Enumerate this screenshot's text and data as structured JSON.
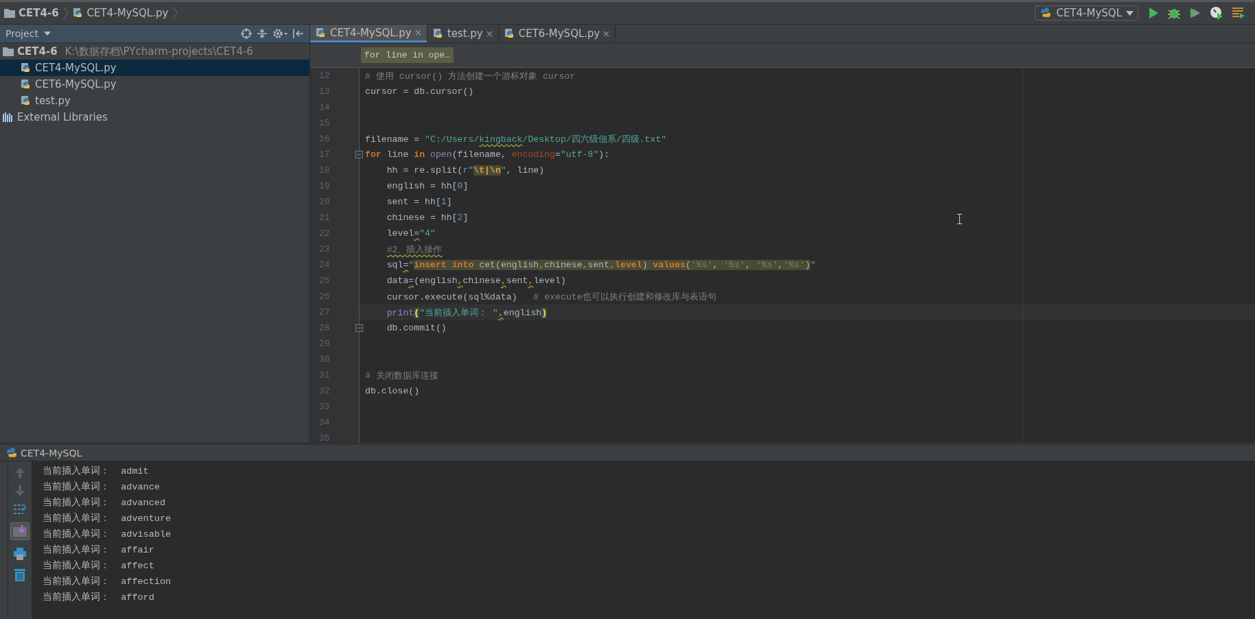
{
  "navbar": {
    "crumbs": [
      {
        "label": "CET4-6",
        "kind": "folder"
      },
      {
        "label": "CET4-MySQL.py",
        "kind": "file"
      }
    ],
    "run_config": "CET4-MySQL"
  },
  "project": {
    "title": "Project",
    "tree": [
      {
        "label": "CET4-6",
        "path": "K:\\数据存档\\PYcharm-projects\\CET4-6",
        "kind": "folder",
        "selected": false,
        "children": [
          {
            "label": "CET4-MySQL.py",
            "kind": "python",
            "selected": true
          },
          {
            "label": "CET6-MySQL.py",
            "kind": "python",
            "selected": false
          },
          {
            "label": "test.py",
            "kind": "python",
            "selected": false
          }
        ]
      },
      {
        "label": "External Libraries",
        "kind": "library",
        "selected": false
      }
    ]
  },
  "tabs": [
    {
      "label": "CET4-MySQL.py",
      "selected": true
    },
    {
      "label": "test.py",
      "selected": false
    },
    {
      "label": "CET6-MySQL.py",
      "selected": false
    }
  ],
  "breadcrumb_hint": "for line in ope…",
  "code": [
    {
      "number": "12",
      "current": false,
      "fold": false,
      "tokens": [
        {
          "text": "# 使用 cursor() 方法创建一个游标对象 cursor",
          "kind": "comment"
        }
      ]
    },
    {
      "number": "13",
      "current": false,
      "fold": false,
      "tokens": [
        {
          "text": "cursor = db.cursor()",
          "kind": "plain"
        }
      ]
    },
    {
      "number": "14",
      "current": false,
      "fold": false
    },
    {
      "number": "15",
      "current": false,
      "fold": false
    },
    {
      "number": "16",
      "current": false,
      "fold": false,
      "tokens": [
        {
          "text": "filename = ",
          "kind": "plain"
        },
        {
          "text": "\"C:/Users/",
          "kind": "string"
        },
        {
          "text": "kingback",
          "kind": "string",
          "underlined": true
        },
        {
          "text": "/Desktop/四六级佃系/四级.txt\"",
          "kind": "string"
        }
      ]
    },
    {
      "number": "17",
      "current": false,
      "fold": true,
      "tokens": [
        {
          "text": "for",
          "kind": "keyword"
        },
        {
          "text": " line ",
          "kind": "plain"
        },
        {
          "text": "in",
          "kind": "keyword"
        },
        {
          "text": " open",
          "kind": "builtin"
        },
        {
          "text": "(filename, ",
          "kind": "plain"
        },
        {
          "text": "encoding",
          "kind": "param"
        },
        {
          "text": "=",
          "kind": "plain"
        },
        {
          "text": "\"utf-8\"",
          "kind": "string"
        },
        {
          "text": "):",
          "kind": "plain"
        }
      ]
    },
    {
      "number": "18",
      "current": false,
      "fold": false,
      "tokens": [
        {
          "text": "    hh = re.split(",
          "kind": "plain"
        },
        {
          "text": "r\"",
          "kind": "string"
        },
        {
          "text": "\\t|\\n",
          "kind": "escape",
          "highlighted": true
        },
        {
          "text": "\"",
          "kind": "string"
        },
        {
          "text": ", line)",
          "kind": "plain"
        }
      ]
    },
    {
      "number": "19",
      "current": false,
      "fold": false,
      "tokens": [
        {
          "text": "    english = hh[",
          "kind": "plain"
        },
        {
          "text": "0",
          "kind": "number"
        },
        {
          "text": "]",
          "kind": "plain"
        }
      ]
    },
    {
      "number": "20",
      "current": false,
      "fold": false,
      "tokens": [
        {
          "text": "    sent = hh[",
          "kind": "plain"
        },
        {
          "text": "1",
          "kind": "number"
        },
        {
          "text": "]",
          "kind": "plain"
        }
      ]
    },
    {
      "number": "21",
      "current": false,
      "fold": false,
      "tokens": [
        {
          "text": "    chinese = hh[",
          "kind": "plain"
        },
        {
          "text": "2",
          "kind": "number"
        },
        {
          "text": "]",
          "kind": "plain"
        }
      ]
    },
    {
      "number": "22",
      "current": false,
      "fold": false,
      "tokens": [
        {
          "text": "    level",
          "kind": "plain"
        },
        {
          "text": "=",
          "kind": "plain",
          "underlined": true
        },
        {
          "text": "\"4\"",
          "kind": "string"
        }
      ]
    },
    {
      "number": "23",
      "current": false,
      "fold": false,
      "tokens": [
        {
          "text": "    #2、插入操作",
          "kind": "comment",
          "underlined": true
        }
      ]
    },
    {
      "number": "24",
      "current": false,
      "fold": false,
      "tokens": [
        {
          "text": "    sql",
          "kind": "plain"
        },
        {
          "text": "=",
          "kind": "plain",
          "underlined": true
        },
        {
          "text": "\"",
          "kind": "string"
        },
        {
          "text": "insert into",
          "kind": "keyword",
          "highlighted": true
        },
        {
          "text": " cet(english",
          "kind": "plain",
          "highlighted": true
        },
        {
          "text": ",",
          "kind": "keyword",
          "highlighted": true
        },
        {
          "text": "chinese",
          "kind": "plain",
          "highlighted": true
        },
        {
          "text": ",",
          "kind": "keyword",
          "highlighted": true
        },
        {
          "text": "sent",
          "kind": "plain",
          "highlighted": true
        },
        {
          "text": ",",
          "kind": "keyword",
          "highlighted": true
        },
        {
          "text": "level",
          "kind": "keyword",
          "highlighted": true
        },
        {
          "text": ") ",
          "kind": "plain",
          "highlighted": true
        },
        {
          "text": "values",
          "kind": "keyword",
          "highlighted": true
        },
        {
          "text": "(",
          "kind": "plain",
          "highlighted": true
        },
        {
          "text": "'%s'",
          "kind": "format",
          "highlighted": true
        },
        {
          "text": ", ",
          "kind": "plain",
          "highlighted": true
        },
        {
          "text": "'%s'",
          "kind": "format",
          "highlighted": true
        },
        {
          "text": ", ",
          "kind": "plain",
          "highlighted": true
        },
        {
          "text": "'%s'",
          "kind": "format",
          "highlighted": true
        },
        {
          "text": ",",
          "kind": "plain",
          "highlighted": true
        },
        {
          "text": "'%s'",
          "kind": "format",
          "highlighted": true
        },
        {
          "text": ")",
          "kind": "plain",
          "highlighted": true
        },
        {
          "text": "\"",
          "kind": "string"
        }
      ]
    },
    {
      "number": "25",
      "current": false,
      "fold": false,
      "tokens": [
        {
          "text": "    data",
          "kind": "plain"
        },
        {
          "text": "=",
          "kind": "plain",
          "underlined": true
        },
        {
          "text": "(english",
          "kind": "plain"
        },
        {
          "text": ",",
          "kind": "keyword",
          "underlined": true
        },
        {
          "text": "chinese",
          "kind": "plain"
        },
        {
          "text": ",",
          "kind": "keyword",
          "underlined": true
        },
        {
          "text": "sent",
          "kind": "plain"
        },
        {
          "text": ",",
          "kind": "keyword",
          "underlined": true
        },
        {
          "text": "level)",
          "kind": "plain"
        }
      ]
    },
    {
      "number": "26",
      "current": false,
      "fold": false,
      "tokens": [
        {
          "text": "    cursor.execute(sql%data)   ",
          "kind": "plain"
        },
        {
          "text": "# execute也可以执行创建和修改库与表语句",
          "kind": "comment"
        }
      ]
    },
    {
      "number": "27",
      "current": true,
      "fold": false,
      "tokens": [
        {
          "text": "    print",
          "kind": "builtin"
        },
        {
          "text": "(",
          "kind": "bracket",
          "highlighted": true
        },
        {
          "text": "\"当前插入单词： \"",
          "kind": "string"
        },
        {
          "text": ",",
          "kind": "keyword",
          "underlined": true
        },
        {
          "text": "english",
          "kind": "plain"
        },
        {
          "text": ")",
          "kind": "bracket",
          "highlighted": true
        }
      ]
    },
    {
      "number": "28",
      "current": false,
      "fold": true,
      "tokens": [
        {
          "text": "    db.commit()",
          "kind": "plain"
        }
      ]
    },
    {
      "number": "29",
      "current": false,
      "fold": false
    },
    {
      "number": "30",
      "current": false,
      "fold": false
    },
    {
      "number": "31",
      "current": false,
      "fold": false,
      "tokens": [
        {
          "text": "# 关闭数据库连接",
          "kind": "comment"
        }
      ]
    },
    {
      "number": "32",
      "current": false,
      "fold": false,
      "tokens": [
        {
          "text": "db.close()",
          "kind": "plain"
        }
      ]
    },
    {
      "number": "33",
      "current": false,
      "fold": false
    },
    {
      "number": "34",
      "current": false,
      "fold": false
    },
    {
      "number": "35",
      "current": false,
      "fold": false
    }
  ],
  "run": {
    "title": "CET4-MySQL",
    "output": [
      "当前插入单词：  admit",
      "当前插入单词：  advance",
      "当前插入单词：  advanced",
      "当前插入单词：  adventure",
      "当前插入单词：  advisable",
      "当前插入单词：  affair",
      "当前插入单词：  affect",
      "当前插入单词：  affection",
      "当前插入单词：  afford"
    ]
  }
}
